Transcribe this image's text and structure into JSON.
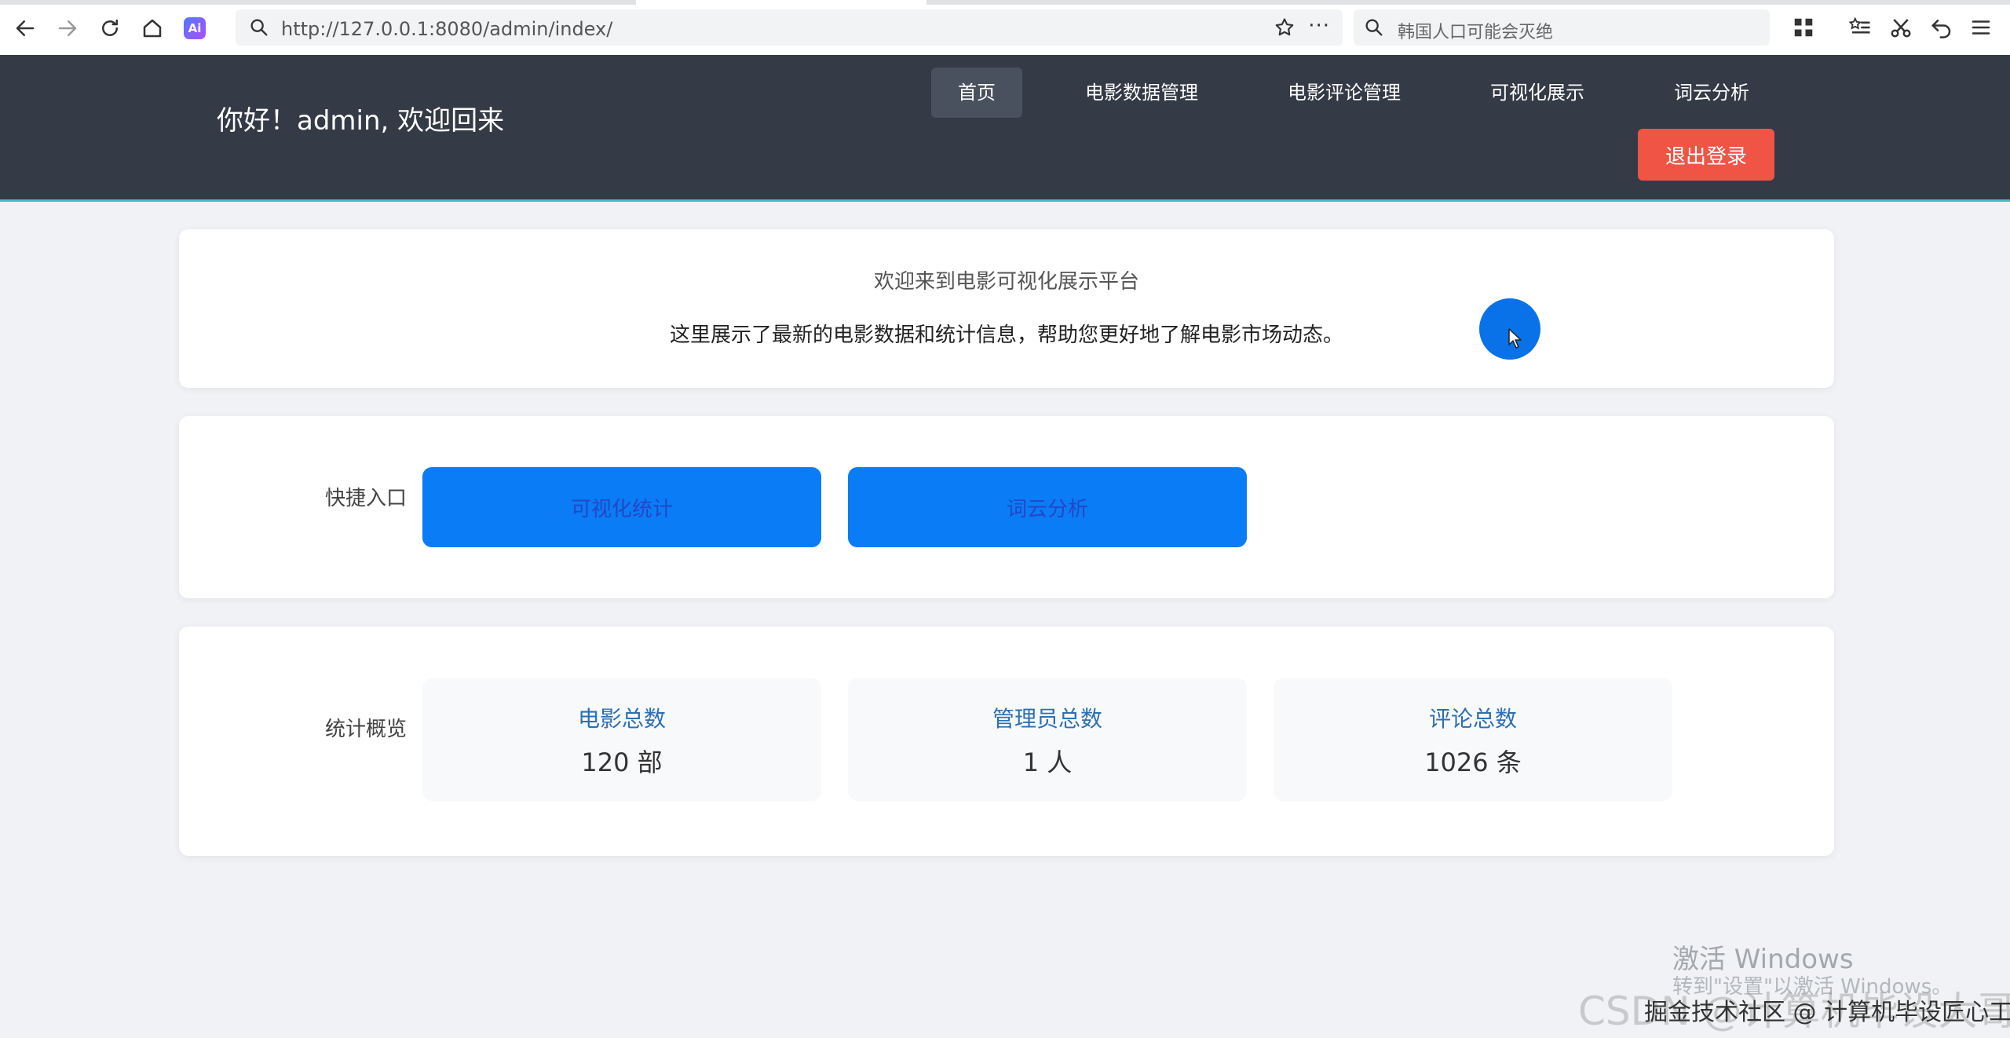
{
  "browser": {
    "url": "http://127.0.0.1:8080/admin/index/",
    "search_text": "韩国人口可能会灭绝",
    "ai_badge": "Ai",
    "more_label": "···"
  },
  "header": {
    "greeting": "你好！admin, 欢迎回来",
    "nav": [
      "首页",
      "电影数据管理",
      "电影评论管理",
      "可视化展示",
      "词云分析"
    ],
    "logout_label": "退出登录"
  },
  "welcome": {
    "title": "欢迎来到电影可视化展示平台",
    "description": "这里展示了最新的电影数据和统计信息，帮助您更好地了解电影市场动态。"
  },
  "quick_entry": {
    "label": "快捷入口",
    "buttons": [
      "可视化统计",
      "词云分析"
    ]
  },
  "stats": {
    "label": "统计概览",
    "items": [
      {
        "label": "电影总数",
        "value": "120 部"
      },
      {
        "label": "管理员总数",
        "value": "1 人"
      },
      {
        "label": "评论总数",
        "value": "1026 条"
      }
    ]
  },
  "overlay": {
    "windows_activate_title": "激活 Windows",
    "windows_activate_sub": "转到\"设置\"以激活 Windows。",
    "csdn_text": "CSDN @计算机毕设大哥",
    "watermark": "掘金技术社区 @ 计算机毕设匠心工作室"
  },
  "colors": {
    "header_bg": "#343a46",
    "accent_blue": "#0a7cf6",
    "logout_red": "#ef5445",
    "page_bg": "#f0f2f5"
  }
}
